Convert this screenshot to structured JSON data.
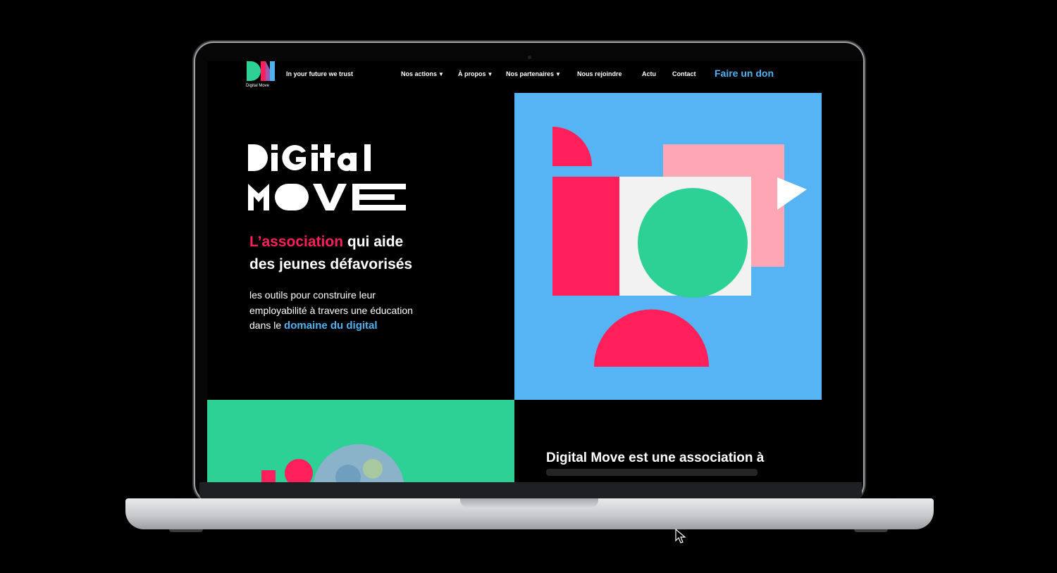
{
  "header": {
    "logo_caption": "Digital Move",
    "tagline": "In your future we trust",
    "nav": [
      {
        "label": "Nos actions",
        "caret": "▼"
      },
      {
        "label": "À propos",
        "caret": "▼"
      },
      {
        "label": "Nos partenaires",
        "caret": "▼"
      },
      {
        "label": "Nous rejoindre"
      },
      {
        "label": "Actu"
      },
      {
        "label": "Contact"
      }
    ],
    "cta": "Faire un don"
  },
  "hero": {
    "wordmark": [
      "DiGital",
      "MOVE"
    ],
    "headline_highlight": "L’association",
    "headline_rest_line1": " qui aide",
    "headline_line2": "des jeunes défavorisés",
    "desc_line1": "les outils pour construire leur",
    "desc_line2": "employabilité à travers une éducation",
    "desc_line3_prefix": "dans le ",
    "desc_link": "domaine du digital"
  },
  "about": {
    "heading": "Digital Move est une association à"
  },
  "colors": {
    "pink": "#ff1f5a",
    "blue": "#56b4f5",
    "link_blue": "#4fb2f0",
    "green": "#2dd196",
    "light_pink": "#ffa6b5",
    "background": "#000000"
  }
}
